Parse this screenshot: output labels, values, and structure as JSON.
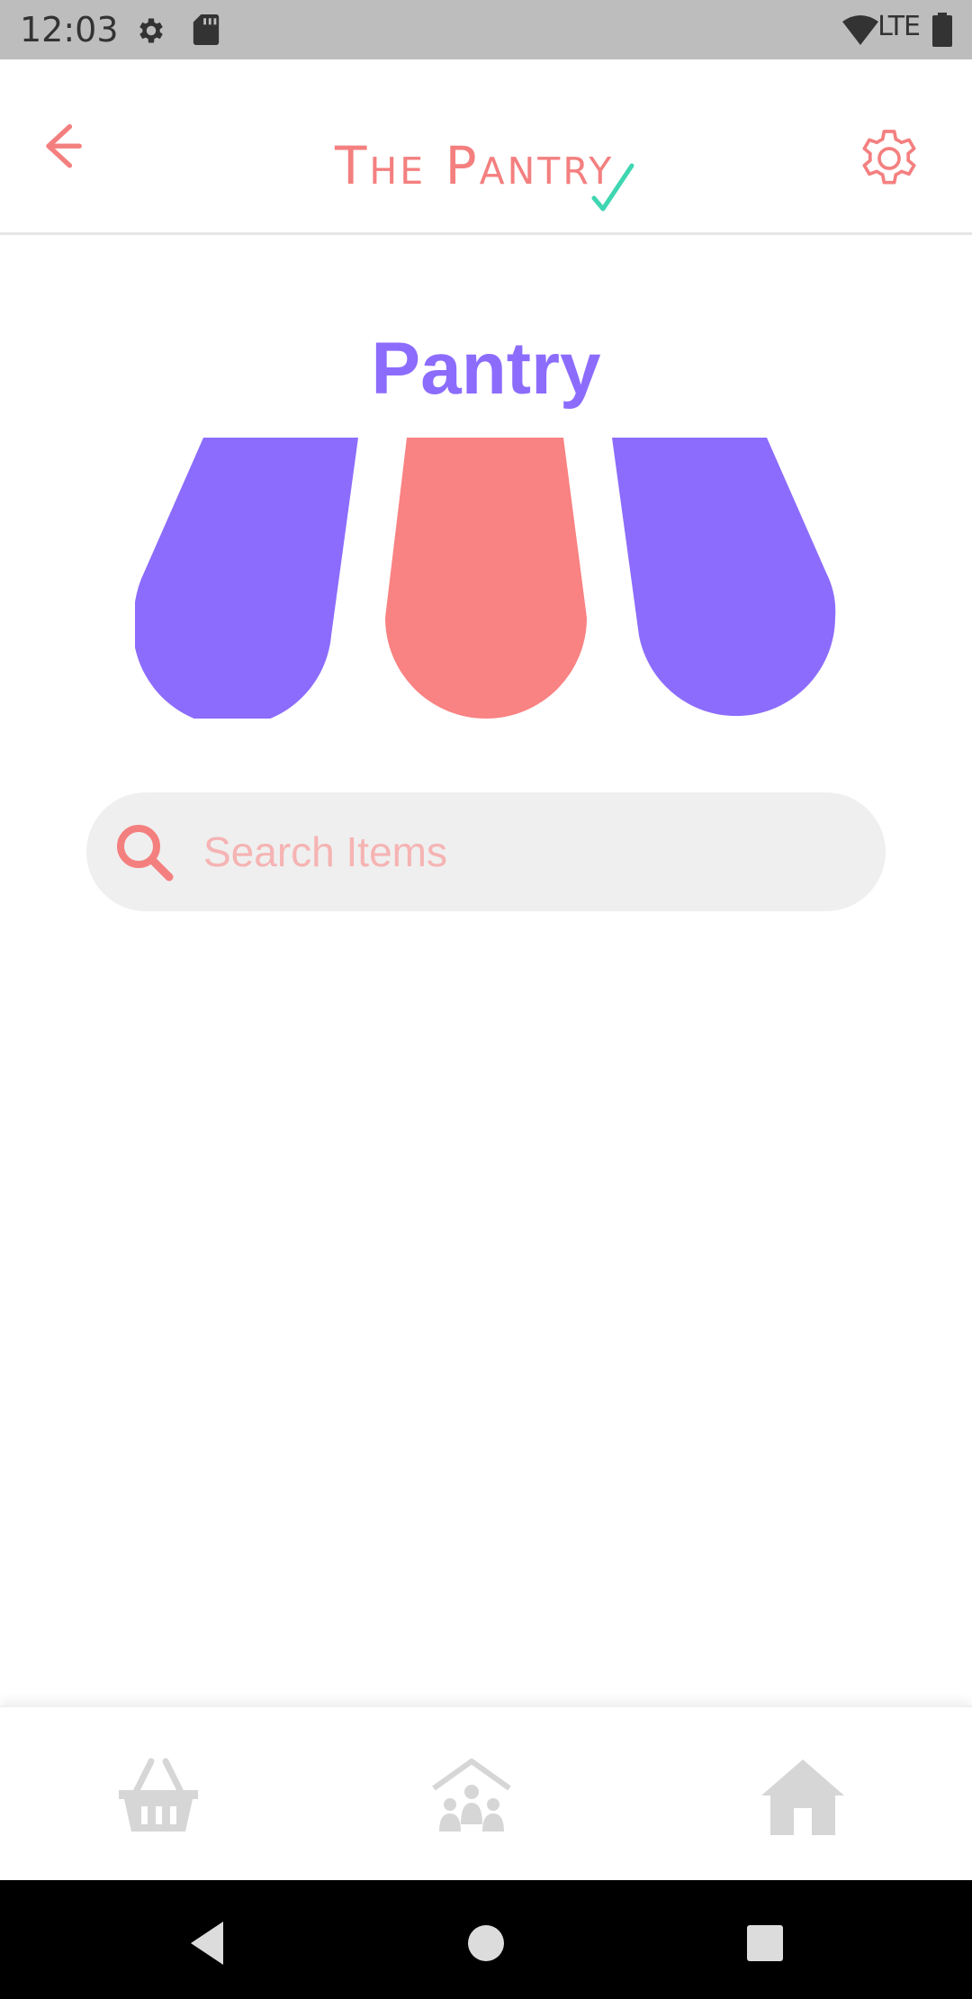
{
  "status_bar": {
    "time": "12:03",
    "network": "LTE",
    "icons": [
      "settings-gear-icon",
      "sd-card-icon",
      "wifi-icon",
      "battery-icon"
    ]
  },
  "header": {
    "brand": "The Pantry",
    "back_icon": "arrow-left-icon",
    "settings_icon": "gear-icon"
  },
  "main": {
    "title": "Pantry",
    "search": {
      "placeholder": "Search Items",
      "value": ""
    }
  },
  "bottom_nav": {
    "items": [
      {
        "icon": "basket-icon"
      },
      {
        "icon": "family-home-icon"
      },
      {
        "icon": "home-icon"
      }
    ]
  },
  "system_nav": {
    "buttons": [
      "back-triangle-icon",
      "home-circle-icon",
      "recents-square-icon"
    ]
  },
  "colors": {
    "accent_pink": "#f47f7f",
    "accent_purple": "#8c6cfc",
    "check_teal": "#3fd6b2",
    "nav_icon_grey": "#d6d6d6",
    "search_bg": "#efefef"
  }
}
